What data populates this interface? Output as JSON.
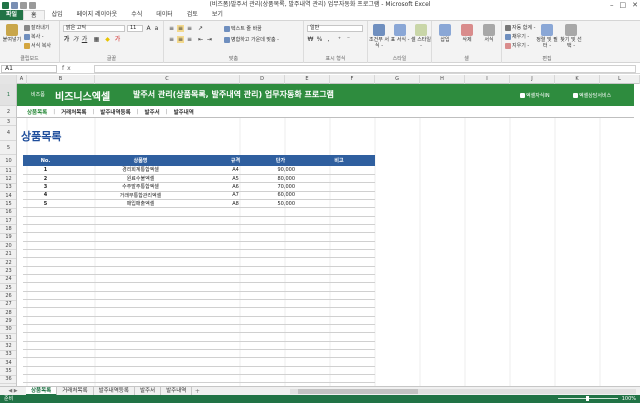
{
  "window": {
    "title": "(비즈폼)발주서 관리(상품목록, 발주내역 관리) 업무자동화 프로그램 - Microsoft Excel",
    "controls": [
      "–",
      "□",
      "✕"
    ]
  },
  "ribbon_tabs": [
    "파일",
    "홈",
    "삽입",
    "페이지 레이아웃",
    "수식",
    "데이터",
    "검토",
    "보기"
  ],
  "ribbon": {
    "paste": "붙여넣기",
    "cut": "잘라내기",
    "copy": "복사 -",
    "format_painter": "서식 복사",
    "clipboard": "클립보드",
    "font_name": "맑은 고딕",
    "font_size": "11",
    "font": "글꼴",
    "wrap_text": "텍스트 줄 바꿈",
    "merge_center": "병합하고 가운데 맞춤 -",
    "alignment": "맞춤",
    "number_format": "일반",
    "number": "표시 형식",
    "cond_format": "조건부 서식 -",
    "table_format": "표 서식 -",
    "cell_style": "셀 스타일 -",
    "styles": "스타일",
    "insert": "삽입",
    "delete": "삭제",
    "format": "서식",
    "cells": "셀",
    "autosum": "자동 합계 -",
    "fill": "채우기 -",
    "clear": "지우기 -",
    "sort_filter": "정렬 및 필터 -",
    "find_select": "찾기 및 선택 -",
    "editing": "편집"
  },
  "formula_bar": {
    "name_box": "A1",
    "fx": "fx",
    "formula": ""
  },
  "columns": [
    "A",
    "B",
    "C",
    "D",
    "E",
    "F",
    "G",
    "H",
    "I",
    "J",
    "K",
    "L"
  ],
  "rows": [
    "1",
    "2",
    "3",
    "4",
    "5",
    "10",
    "11",
    "12",
    "13",
    "14",
    "15",
    "16",
    "17",
    "18",
    "19",
    "20",
    "21",
    "22",
    "23",
    "24",
    "25",
    "26",
    "27",
    "28",
    "29",
    "30",
    "31",
    "32",
    "33",
    "34",
    "35",
    "36",
    "37",
    "38",
    "39",
    "40"
  ],
  "banner": {
    "brand_small": "비즈폼",
    "brand": "비즈니스엑셀",
    "title": "발주서 관리(상품목록, 발주내역 관리) 업무자동화 프로그램",
    "link1": "엑셀자식IN",
    "link2": "엑셀상담서비스"
  },
  "nav": [
    "상품목록",
    "거래처목록",
    "발주내역등록",
    "발주서",
    "발주내역"
  ],
  "page_title": "상품목록",
  "table": {
    "headers": [
      "No.",
      "상품명",
      "규격",
      "단가",
      "비고"
    ],
    "rows": [
      [
        "1",
        "경리회계통합엑셀",
        "A4",
        "90,000",
        ""
      ],
      [
        "2",
        "원료수불엑셀",
        "A5",
        "80,000",
        ""
      ],
      [
        "3",
        "수주발주통합엑셀",
        "A6",
        "70,000",
        ""
      ],
      [
        "4",
        "거래부통합관리엑셀",
        "A7",
        "60,000",
        ""
      ],
      [
        "5",
        "매입매출엑셀",
        "A8",
        "50,000",
        ""
      ]
    ]
  },
  "sheet_tabs": [
    "상품목록",
    "거래처목록",
    "발주내역등록",
    "발주서",
    "발주내역"
  ],
  "status": {
    "ready": "준비",
    "zoom": "100%"
  },
  "colors": {
    "excel_green": "#217346",
    "banner_green": "#2e8c3e",
    "header_blue": "#2f5f9f",
    "title_blue": "#1f4e9c"
  }
}
